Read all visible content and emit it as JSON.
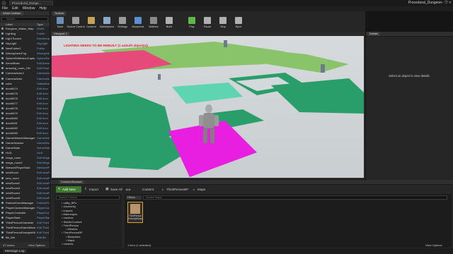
{
  "window": {
    "tab_title": "Procedural_Dunge...",
    "project_name": "Procedural_Dungeon",
    "controls": "—  ❐  ✕"
  },
  "menu": [
    "File",
    "Edit",
    "Window",
    "Help"
  ],
  "outliner": {
    "tab": "World Outliner",
    "search_placeholder": "Search...",
    "col_label": "Label",
    "col_type": "Type",
    "rows": [
      {
        "name": "Dungeon_Maker_Map",
        "type": "World"
      },
      {
        "name": "Lighting",
        "type": "Folder"
      },
      {
        "name": "Light Source",
        "type": "DirectionalL"
      },
      {
        "name": "SkyLight",
        "type": "SkyLight"
      },
      {
        "name": "NewFolder2",
        "type": "Folder"
      },
      {
        "name": "AtmosphericFog",
        "type": "Atmospheri"
      },
      {
        "name": "SphereReflectionCaptu",
        "type": "SphereRefle"
      },
      {
        "name": "ArrowBrain",
        "type": "Edit Arrow"
      },
      {
        "name": "amazing_room_ON",
        "type": "Edit Rooms"
      },
      {
        "name": "CameraActor2",
        "type": "CameraActo"
      },
      {
        "name": "CameraActor",
        "type": "CameraActo"
      },
      {
        "name": "cube",
        "type": "StaticMeshA"
      },
      {
        "name": "door8474",
        "type": "Edit door"
      },
      {
        "name": "door8475",
        "type": "Edit door"
      },
      {
        "name": "door8476",
        "type": "Edit door"
      },
      {
        "name": "door8477",
        "type": "Edit door"
      },
      {
        "name": "door8478",
        "type": "Edit door"
      },
      {
        "name": "door8479",
        "type": "Edit door"
      },
      {
        "name": "door8480",
        "type": "Edit door"
      },
      {
        "name": "door8481",
        "type": "Edit door"
      },
      {
        "name": "door8482",
        "type": "Edit door"
      },
      {
        "name": "door8483",
        "type": "Edit door"
      },
      {
        "name": "GameNetworkManager",
        "type": "GameNetwo"
      },
      {
        "name": "GameSession",
        "type": "GameSessio"
      },
      {
        "name": "GameState",
        "type": "GameState"
      },
      {
        "name": "HUD",
        "type": "HUD"
      },
      {
        "name": "mega_room",
        "type": "Edit Mega"
      },
      {
        "name": "mega_room2",
        "type": "Edit Mega"
      },
      {
        "name": "NetworkPlayerStart",
        "type": "NetworkPlay"
      },
      {
        "name": "newRoom",
        "type": "Edit newR"
      },
      {
        "name": "new_room",
        "type": "Edit newR"
      },
      {
        "name": "newRoom2",
        "type": "Edit newR"
      },
      {
        "name": "newRoom3",
        "type": "Edit newR"
      },
      {
        "name": "newRoom4",
        "type": "Edit newR"
      },
      {
        "name": "newRoom5",
        "type": "Edit newR"
      },
      {
        "name": "ParticleEventManager",
        "type": "ParticleEven"
      },
      {
        "name": "PlayerCameraManager",
        "type": "PlayerCame"
      },
      {
        "name": "PlayerController",
        "type": "PlayerContr"
      },
      {
        "name": "PlayerState",
        "type": "PlayerState"
      },
      {
        "name": "ThirdPersonCharacter",
        "type": "Edit Third"
      },
      {
        "name": "ThirdPersonGameMode",
        "type": "Edit Third"
      },
      {
        "name": "ThirdPersonExampleMap",
        "type": "Edit Third"
      },
      {
        "name": "tile_flat",
        "type": "Edit tile"
      }
    ],
    "footer_count": "47 actors",
    "view_options": "View Options"
  },
  "toolbar": {
    "tab": "Toolbar",
    "buttons": [
      {
        "label": "Save",
        "color": "#6d8fb3"
      },
      {
        "label": "Source Control",
        "color": "#9a9a9a"
      },
      {
        "label": "Content",
        "color": "#c9a25a"
      },
      {
        "label": "Marketplace",
        "color": "#8aa8c8"
      },
      {
        "label": "Settings",
        "color": "#9a9a9a"
      },
      {
        "label": "Blueprints",
        "color": "#5b8fd1"
      },
      {
        "label": "Matinee",
        "color": "#8a8a8a"
      },
      {
        "label": "Build",
        "color": "#b0b0b0"
      },
      {
        "label": "Play",
        "color": "#5fb84a"
      },
      {
        "label": "Pause",
        "color": "#b0b0b0"
      },
      {
        "label": "Stop",
        "color": "#b0b0b0"
      },
      {
        "label": "Eject",
        "color": "#b0b0b0"
      }
    ]
  },
  "viewport": {
    "tab": "Viewport 1",
    "warning": "LIGHTING NEEDS TO BE REBUILT (1 unbuilt object(s))",
    "colors": {
      "green": "#2a9e6a",
      "light_green": "#8ac46a",
      "mint": "#5fd4b0",
      "pink": "#e64a7a",
      "magenta": "#e81ee0"
    }
  },
  "details": {
    "tab": "Details",
    "message": "Select an object to view details."
  },
  "content_browser": {
    "tab": "Content Browser",
    "add_new": "Add New",
    "import": "Import",
    "save_all": "Save All",
    "breadcrumb": [
      "Content",
      "ThirdPersonBP",
      "Maps"
    ],
    "filters": "Filters",
    "search_placeholder": "Search Maps",
    "tree_search_placeholder": "Search Folders",
    "tree": [
      {
        "label": "utility_BPs",
        "depth": 1
      },
      {
        "label": "Geometry",
        "depth": 1
      },
      {
        "label": "imports",
        "depth": 1
      },
      {
        "label": "Mannequin",
        "depth": 1
      },
      {
        "label": "meshes",
        "depth": 1
      },
      {
        "label": "StarterContent",
        "depth": 1
      },
      {
        "label": "ThirdPerson",
        "depth": 1
      },
      {
        "label": "Meshes",
        "depth": 2
      },
      {
        "label": "ThirdPersonBP",
        "depth": 1
      },
      {
        "label": "Blueprints",
        "depth": 2
      },
      {
        "label": "Maps",
        "depth": 2
      },
      {
        "label": "meshes",
        "depth": 1
      }
    ],
    "asset_name": "ThirdPerson ExampleMap",
    "item_count": "1 item (1 selected)",
    "view_options": "View Options"
  },
  "statusbar": {
    "message_log": "Message Log"
  }
}
